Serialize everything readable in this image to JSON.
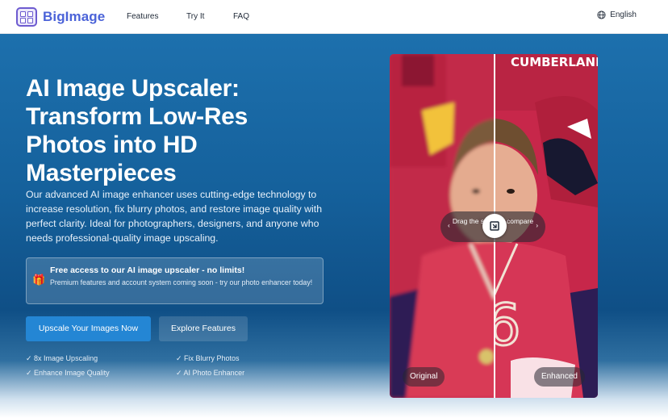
{
  "nav": {
    "logo_text": "BigImage",
    "links": [
      "Features",
      "Try It",
      "FAQ"
    ],
    "language": "English"
  },
  "hero": {
    "title": "AI Image Upscaler: Transform Low-Res Photos into HD Masterpieces",
    "description": "Our advanced AI image enhancer uses cutting-edge technology to increase resolution, fix blurry photos, and restore image quality with perfect clarity. Ideal for photographers, designers, and anyone who needs professional-quality image upscaling.",
    "notice": {
      "title": "Free access to our AI image upscaler - no limits!",
      "subtitle": "Premium features and account system coming soon - try our photo enhancer today!",
      "icon": "gift-icon"
    },
    "primary_button": "Upscale Your Images Now",
    "secondary_button": "Explore Features",
    "features": [
      "✓ 8x Image Upscaling",
      "✓ Fix Blurry Photos",
      "✓ Enhance Image Quality",
      "✓ AI Photo Enhancer"
    ]
  },
  "comparison": {
    "hint": "Drag the slider to compare",
    "label_left": "Original",
    "label_right": "Enhanced",
    "jersey_text_top": "CUMBERLAND",
    "jersey_number": "6"
  },
  "colors": {
    "brand": "#4b63d8",
    "hero_top": "#1d70ad",
    "hero_bottom": "#0f4f86",
    "primary_button": "#2486d4",
    "jersey_red": "#c8284a"
  }
}
